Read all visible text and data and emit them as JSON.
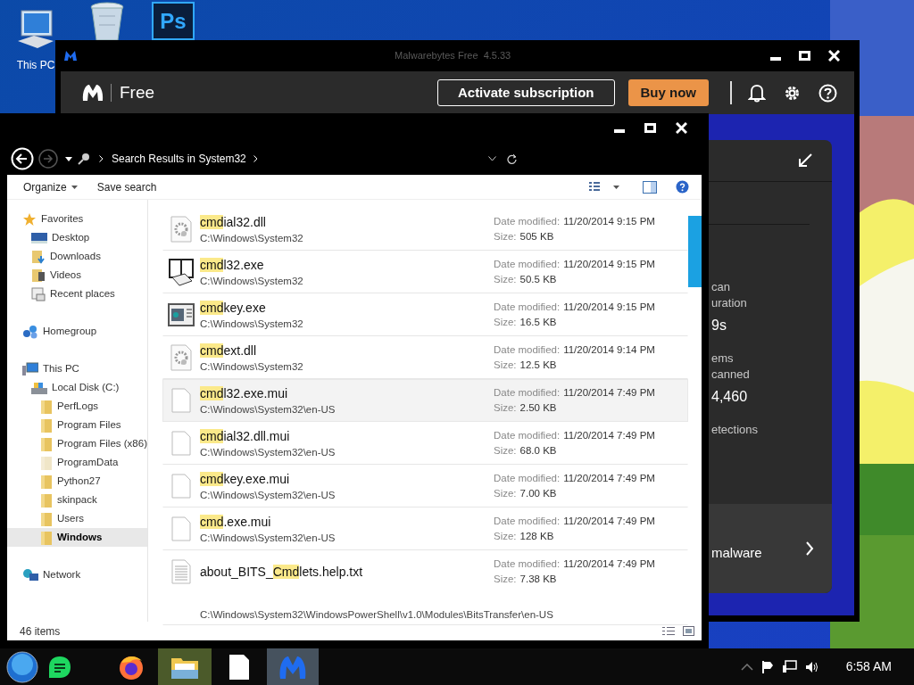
{
  "desktop": {
    "icons": [
      {
        "kind": "computer",
        "label": "This PC"
      },
      {
        "kind": "recycle-bin"
      },
      {
        "kind": "photoshop",
        "glyph": "Ps"
      }
    ]
  },
  "malwarebytes": {
    "title": "Malwarebytes Free  4.5.33",
    "plan": "Free",
    "activate_button": "Activate subscription",
    "buy_button": "Buy now",
    "scan_card": {
      "stats": [
        {
          "label_lines": [
            "can",
            "uration"
          ],
          "value": "9s"
        },
        {
          "label_lines": [
            "ems",
            "canned"
          ],
          "value": "4,460"
        },
        {
          "label_lines": [
            "etections"
          ]
        }
      ],
      "footer": "malware"
    }
  },
  "explorer": {
    "breadcrumb": "Search Results in System32",
    "organize": "Organize",
    "save_search": "Save search",
    "nav": [
      {
        "label": "Favorites",
        "kind": "star",
        "selected": false,
        "children": [
          {
            "label": "Desktop",
            "kind": "desktop",
            "selected": false
          },
          {
            "label": "Downloads",
            "kind": "downloads",
            "selected": false
          },
          {
            "label": "Videos",
            "kind": "videos",
            "selected": false
          },
          {
            "label": "Recent places",
            "kind": "recent",
            "selected": false
          }
        ]
      },
      {
        "label": "Homegroup",
        "kind": "homegroup",
        "selected": false
      },
      {
        "label": "This PC",
        "kind": "pc",
        "selected": false,
        "children": [
          {
            "label": "Local Disk (C:)",
            "kind": "disk",
            "selected": false,
            "children": [
              {
                "label": "PerfLogs",
                "kind": "folder",
                "selected": false,
                "dimmed": false
              },
              {
                "label": "Program Files",
                "kind": "folder",
                "selected": false,
                "dimmed": false
              },
              {
                "label": "Program Files (x86)",
                "kind": "folder",
                "selected": false,
                "dimmed": false
              },
              {
                "label": "ProgramData",
                "kind": "folder",
                "selected": false,
                "dimmed": true
              },
              {
                "label": "Python27",
                "kind": "folder",
                "selected": false,
                "dimmed": false
              },
              {
                "label": "skinpack",
                "kind": "folder",
                "selected": false,
                "dimmed": false
              },
              {
                "label": "Users",
                "kind": "folder",
                "selected": false,
                "dimmed": false
              },
              {
                "label": "Windows",
                "kind": "folder",
                "selected": true,
                "dimmed": false
              }
            ]
          }
        ]
      },
      {
        "label": "Network",
        "kind": "network",
        "selected": false
      }
    ],
    "files": [
      {
        "kind": "gear-file",
        "hit": "cmd",
        "post": "ial32.dll",
        "path": "C:\\Windows\\System32",
        "date_label": "Date modified:",
        "date": "11/20/2014 9:15 PM",
        "size_label": "Size:",
        "size": "505 KB",
        "hovered": false,
        "path_wrapped": false
      },
      {
        "kind": "phone-app",
        "hit": "cmd",
        "post": "l32.exe",
        "path": "C:\\Windows\\System32",
        "date_label": "Date modified:",
        "date": "11/20/2014 9:15 PM",
        "size_label": "Size:",
        "size": "50.5 KB",
        "hovered": false,
        "path_wrapped": false
      },
      {
        "kind": "window-app",
        "hit": "cmd",
        "post": "key.exe",
        "path": "C:\\Windows\\System32",
        "date_label": "Date modified:",
        "date": "11/20/2014 9:15 PM",
        "size_label": "Size:",
        "size": "16.5 KB",
        "hovered": false,
        "path_wrapped": false
      },
      {
        "kind": "gear-file",
        "hit": "cmd",
        "post": "ext.dll",
        "path": "C:\\Windows\\System32",
        "date_label": "Date modified:",
        "date": "11/20/2014 9:14 PM",
        "size_label": "Size:",
        "size": "12.5 KB",
        "hovered": false,
        "path_wrapped": false
      },
      {
        "kind": "blank",
        "hit": "cmd",
        "post": "l32.exe.mui",
        "path": "C:\\Windows\\System32\\en-US",
        "date_label": "Date modified:",
        "date": "11/20/2014 7:49 PM",
        "size_label": "Size:",
        "size": "2.50 KB",
        "hovered": true,
        "path_wrapped": false
      },
      {
        "kind": "blank",
        "hit": "cmd",
        "post": "ial32.dll.mui",
        "path": "C:\\Windows\\System32\\en-US",
        "date_label": "Date modified:",
        "date": "11/20/2014 7:49 PM",
        "size_label": "Size:",
        "size": "68.0 KB",
        "hovered": false,
        "path_wrapped": false
      },
      {
        "kind": "blank",
        "hit": "cmd",
        "post": "key.exe.mui",
        "path": "C:\\Windows\\System32\\en-US",
        "date_label": "Date modified:",
        "date": "11/20/2014 7:49 PM",
        "size_label": "Size:",
        "size": "7.00 KB",
        "hovered": false,
        "path_wrapped": false
      },
      {
        "kind": "blank",
        "hit": "cmd",
        "post": ".exe.mui",
        "path": "C:\\Windows\\System32\\en-US",
        "date_label": "Date modified:",
        "date": "11/20/2014 7:49 PM",
        "size_label": "Size:",
        "size": "128 KB",
        "hovered": false,
        "path_wrapped": false
      },
      {
        "kind": "text",
        "pre": "about_BITS_",
        "hit": "Cmd",
        "post": "lets.help.txt",
        "path": "C:\\Windows\\System32\\WindowsPowerShell\\v1.0\\Modules\\BitsTransfer\\en-US",
        "date_label": "Date modified:",
        "date": "11/20/2014 7:49 PM",
        "size_label": "Size:",
        "size": "7.38 KB",
        "hovered": false,
        "path_wrapped": true
      }
    ],
    "status": "46 items"
  },
  "taskbar": {
    "apps": [
      {
        "kind": "start",
        "active": false
      },
      {
        "kind": "chat",
        "active": false
      },
      {
        "kind": "firefox",
        "active": false
      },
      {
        "kind": "explorer",
        "active": true
      },
      {
        "kind": "file",
        "active": false
      },
      {
        "kind": "malwarebytes",
        "active": true
      }
    ],
    "clock": "6:58 AM"
  }
}
